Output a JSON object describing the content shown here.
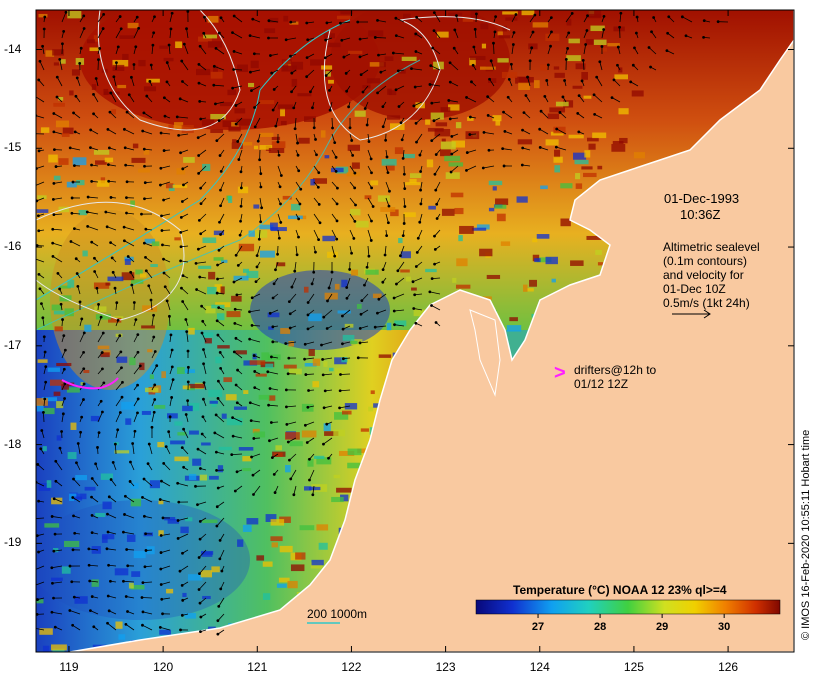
{
  "map": {
    "lat_ticks": [
      "-14",
      "-15",
      "-16",
      "-17",
      "-18",
      "-19"
    ],
    "lon_ticks": [
      "119",
      "120",
      "121",
      "122",
      "123",
      "124",
      "125",
      "126"
    ],
    "lat_range": [
      -20.1,
      -13.6
    ],
    "lon_range": [
      118.65,
      126.7
    ]
  },
  "annotations": {
    "date": "01-Dec-1993",
    "time": "10:36Z",
    "sealevel_lines": [
      "Altimetric sealevel",
      "(0.1m contours)",
      "and velocity for",
      "01-Dec 10Z",
      "0.5m/s (1kt 24h)"
    ],
    "drifter_marker": ">",
    "drifter_lines": [
      "drifters@12h to",
      "01/12 12Z"
    ],
    "isobath_label": "200  1000m",
    "credit": "© IMOS 16-Feb-2020 10:55:11 Hobart time"
  },
  "colorbar": {
    "title": "Temperature (°C) NOAA 12 23% ql>=4",
    "ticks": [
      "27",
      "28",
      "29",
      "30"
    ],
    "tick_values": [
      27,
      28,
      29,
      30
    ],
    "range": [
      26.0,
      30.9
    ]
  },
  "colors": {
    "land": "#f9c9a0",
    "ocean_warm": "#a01800",
    "ocean_mid": "#e4d000",
    "ocean_cool": "#30a0e0",
    "drifter": "#ff20ff",
    "isobath": "#30c8c8"
  }
}
